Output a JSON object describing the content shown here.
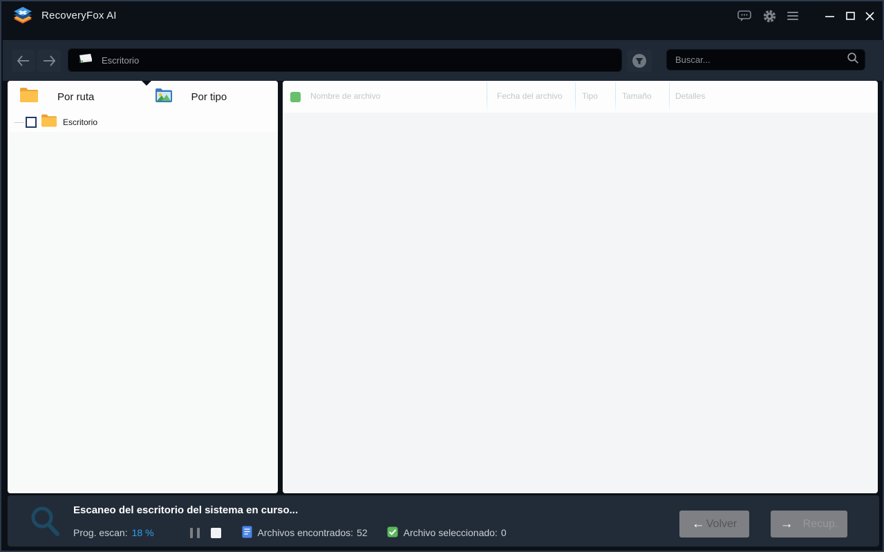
{
  "window": {
    "title": "RecoveryFox AI"
  },
  "navbar": {
    "path_value": "Escritorio",
    "search_placeholder": "Buscar..."
  },
  "left_panel": {
    "tabs": [
      {
        "label": "Por ruta"
      },
      {
        "label": "Por tipo"
      }
    ],
    "tree": [
      {
        "label": "Escritorio",
        "checked": false
      }
    ]
  },
  "table": {
    "columns": [
      "Nombre de archivo",
      "Fecha del archivo",
      "Tipo",
      "Tamaño",
      "Detalles"
    ],
    "rows": []
  },
  "footer": {
    "status_title": "Escaneo del escritorio del sistema en curso...",
    "progress_label": "Prog. escan:",
    "progress_value": "18 %",
    "found_label": "Archivos encontrados:",
    "found_value": "52",
    "selected_label": "Archivo seleccionado:",
    "selected_value": "0",
    "back_button": "Volver",
    "recover_button": "Recup."
  },
  "colors": {
    "accent_blue": "#31a0ea",
    "green": "#68bf6c",
    "footer_bg": "#222c38",
    "navbar_bg": "#1f2835",
    "titlebar_bg": "#0c1117"
  }
}
